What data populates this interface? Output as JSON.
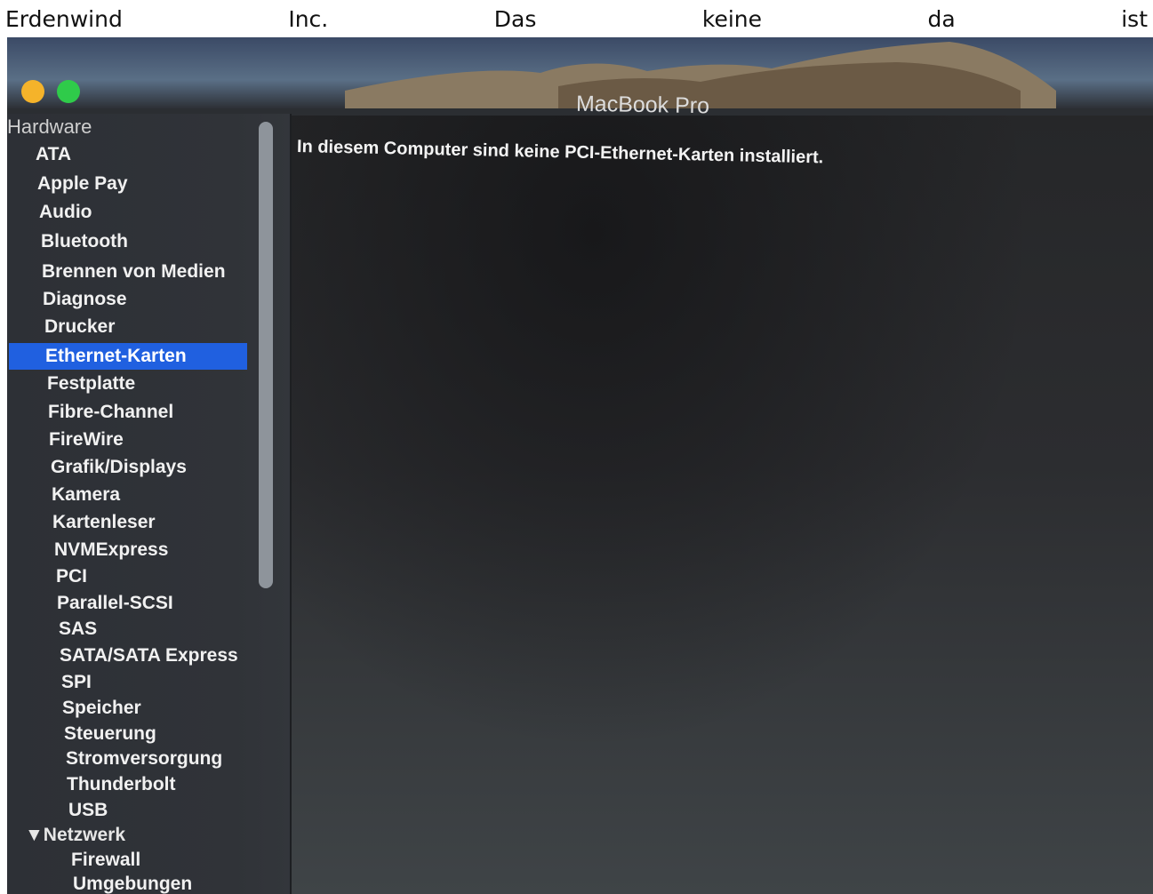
{
  "caption": {
    "words": [
      "Erdenwind",
      "Inc.",
      "Das",
      "keine",
      "da",
      "ist"
    ]
  },
  "window": {
    "title": "MacBook Pro",
    "traffic_lights": {
      "yellow": "#f5b32a",
      "green": "#2fcb4a"
    }
  },
  "sidebar": {
    "section": "Hardware",
    "items": [
      "ATA",
      "Apple Pay",
      "Audio",
      "Bluetooth",
      "Brennen von Medien",
      "Diagnose",
      "Drucker",
      "Ethernet-Karten",
      "Festplatte",
      "Fibre-Channel",
      "FireWire",
      "Grafik/Displays",
      "Kamera",
      "Kartenleser",
      "NVMExpress",
      "PCI",
      "Parallel-SCSI",
      "SAS",
      "SATA/SATA Express",
      "SPI",
      "Speicher",
      "Steuerung",
      "Stromversorgung",
      "Thunderbolt",
      "USB"
    ],
    "selected": "Ethernet-Karten",
    "network": {
      "label": "Netzwerk",
      "items": [
        "Firewall",
        "Umgebungen"
      ]
    },
    "selection_color": "#2060e0"
  },
  "main": {
    "message": "In diesem Computer sind keine PCI-Ethernet-Karten installiert."
  }
}
